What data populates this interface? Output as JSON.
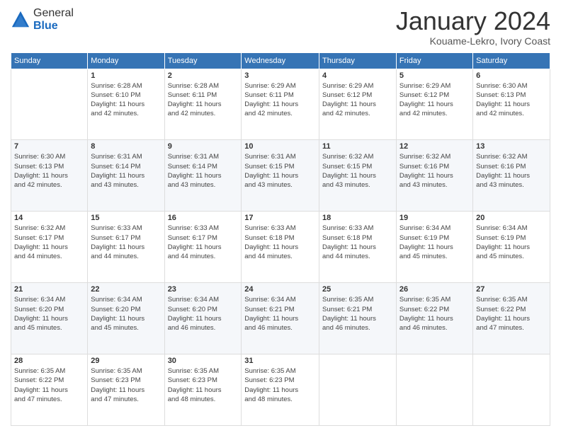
{
  "logo": {
    "general": "General",
    "blue": "Blue"
  },
  "header": {
    "title": "January 2024",
    "subtitle": "Kouame-Lekro, Ivory Coast"
  },
  "weekdays": [
    "Sunday",
    "Monday",
    "Tuesday",
    "Wednesday",
    "Thursday",
    "Friday",
    "Saturday"
  ],
  "weeks": [
    [
      {
        "day": "",
        "info": ""
      },
      {
        "day": "1",
        "info": "Sunrise: 6:28 AM\nSunset: 6:10 PM\nDaylight: 11 hours\nand 42 minutes."
      },
      {
        "day": "2",
        "info": "Sunrise: 6:28 AM\nSunset: 6:11 PM\nDaylight: 11 hours\nand 42 minutes."
      },
      {
        "day": "3",
        "info": "Sunrise: 6:29 AM\nSunset: 6:11 PM\nDaylight: 11 hours\nand 42 minutes."
      },
      {
        "day": "4",
        "info": "Sunrise: 6:29 AM\nSunset: 6:12 PM\nDaylight: 11 hours\nand 42 minutes."
      },
      {
        "day": "5",
        "info": "Sunrise: 6:29 AM\nSunset: 6:12 PM\nDaylight: 11 hours\nand 42 minutes."
      },
      {
        "day": "6",
        "info": "Sunrise: 6:30 AM\nSunset: 6:13 PM\nDaylight: 11 hours\nand 42 minutes."
      }
    ],
    [
      {
        "day": "7",
        "info": "Sunrise: 6:30 AM\nSunset: 6:13 PM\nDaylight: 11 hours\nand 42 minutes."
      },
      {
        "day": "8",
        "info": "Sunrise: 6:31 AM\nSunset: 6:14 PM\nDaylight: 11 hours\nand 43 minutes."
      },
      {
        "day": "9",
        "info": "Sunrise: 6:31 AM\nSunset: 6:14 PM\nDaylight: 11 hours\nand 43 minutes."
      },
      {
        "day": "10",
        "info": "Sunrise: 6:31 AM\nSunset: 6:15 PM\nDaylight: 11 hours\nand 43 minutes."
      },
      {
        "day": "11",
        "info": "Sunrise: 6:32 AM\nSunset: 6:15 PM\nDaylight: 11 hours\nand 43 minutes."
      },
      {
        "day": "12",
        "info": "Sunrise: 6:32 AM\nSunset: 6:16 PM\nDaylight: 11 hours\nand 43 minutes."
      },
      {
        "day": "13",
        "info": "Sunrise: 6:32 AM\nSunset: 6:16 PM\nDaylight: 11 hours\nand 43 minutes."
      }
    ],
    [
      {
        "day": "14",
        "info": "Sunrise: 6:32 AM\nSunset: 6:17 PM\nDaylight: 11 hours\nand 44 minutes."
      },
      {
        "day": "15",
        "info": "Sunrise: 6:33 AM\nSunset: 6:17 PM\nDaylight: 11 hours\nand 44 minutes."
      },
      {
        "day": "16",
        "info": "Sunrise: 6:33 AM\nSunset: 6:17 PM\nDaylight: 11 hours\nand 44 minutes."
      },
      {
        "day": "17",
        "info": "Sunrise: 6:33 AM\nSunset: 6:18 PM\nDaylight: 11 hours\nand 44 minutes."
      },
      {
        "day": "18",
        "info": "Sunrise: 6:33 AM\nSunset: 6:18 PM\nDaylight: 11 hours\nand 44 minutes."
      },
      {
        "day": "19",
        "info": "Sunrise: 6:34 AM\nSunset: 6:19 PM\nDaylight: 11 hours\nand 45 minutes."
      },
      {
        "day": "20",
        "info": "Sunrise: 6:34 AM\nSunset: 6:19 PM\nDaylight: 11 hours\nand 45 minutes."
      }
    ],
    [
      {
        "day": "21",
        "info": "Sunrise: 6:34 AM\nSunset: 6:20 PM\nDaylight: 11 hours\nand 45 minutes."
      },
      {
        "day": "22",
        "info": "Sunrise: 6:34 AM\nSunset: 6:20 PM\nDaylight: 11 hours\nand 45 minutes."
      },
      {
        "day": "23",
        "info": "Sunrise: 6:34 AM\nSunset: 6:20 PM\nDaylight: 11 hours\nand 46 minutes."
      },
      {
        "day": "24",
        "info": "Sunrise: 6:34 AM\nSunset: 6:21 PM\nDaylight: 11 hours\nand 46 minutes."
      },
      {
        "day": "25",
        "info": "Sunrise: 6:35 AM\nSunset: 6:21 PM\nDaylight: 11 hours\nand 46 minutes."
      },
      {
        "day": "26",
        "info": "Sunrise: 6:35 AM\nSunset: 6:22 PM\nDaylight: 11 hours\nand 46 minutes."
      },
      {
        "day": "27",
        "info": "Sunrise: 6:35 AM\nSunset: 6:22 PM\nDaylight: 11 hours\nand 47 minutes."
      }
    ],
    [
      {
        "day": "28",
        "info": "Sunrise: 6:35 AM\nSunset: 6:22 PM\nDaylight: 11 hours\nand 47 minutes."
      },
      {
        "day": "29",
        "info": "Sunrise: 6:35 AM\nSunset: 6:23 PM\nDaylight: 11 hours\nand 47 minutes."
      },
      {
        "day": "30",
        "info": "Sunrise: 6:35 AM\nSunset: 6:23 PM\nDaylight: 11 hours\nand 48 minutes."
      },
      {
        "day": "31",
        "info": "Sunrise: 6:35 AM\nSunset: 6:23 PM\nDaylight: 11 hours\nand 48 minutes."
      },
      {
        "day": "",
        "info": ""
      },
      {
        "day": "",
        "info": ""
      },
      {
        "day": "",
        "info": ""
      }
    ]
  ]
}
